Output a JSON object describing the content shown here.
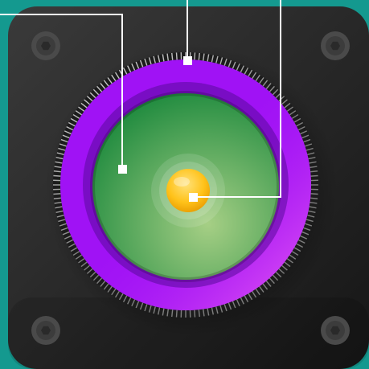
{
  "colors": {
    "background": "#14998f",
    "panel_light": "#3a3a3a",
    "panel_dark": "#161616",
    "screw": "#4a4a4a",
    "knurl_ring": "#cfcfcf",
    "bezel_outer": "#a012f5",
    "bezel_highlight": "#ec5cf3",
    "bezel_inner_shadow": "#5a0a9a",
    "lens_green_dark": "#1e8a3e",
    "lens_green_light": "#a6cf85",
    "center_button": "#ffc21a",
    "callout_line": "#ffffff"
  },
  "device": {
    "screws": [
      "top-left",
      "top-right",
      "bottom-left",
      "bottom-right"
    ],
    "callouts": [
      "lens-bezel",
      "lens-surface",
      "center-button"
    ]
  }
}
